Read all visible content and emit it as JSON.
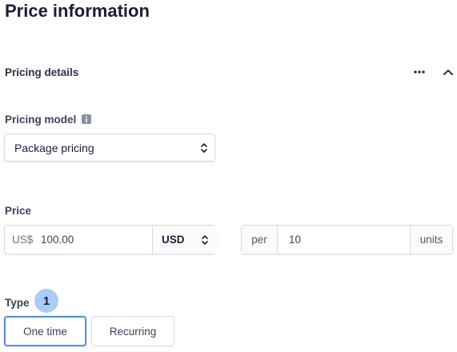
{
  "page": {
    "title": "Price information"
  },
  "section": {
    "title": "Pricing details",
    "more_icon": "ellipsis-icon",
    "collapse_icon": "chevron-up-icon"
  },
  "pricing_model": {
    "label": "Pricing model",
    "info_icon": "info-icon",
    "selected": "Package pricing"
  },
  "price": {
    "label": "Price",
    "prefix": "US$",
    "amount": "100.00",
    "currency": "USD"
  },
  "units": {
    "per_label": "per",
    "quantity": "10",
    "suffix": "units"
  },
  "type": {
    "label": "Type",
    "step_badge": "1",
    "options": [
      "One time",
      "Recurring"
    ],
    "selected": "One time"
  },
  "colors": {
    "selected_border": "#5b8fd6",
    "badge_bg": "#a9cdf7"
  }
}
